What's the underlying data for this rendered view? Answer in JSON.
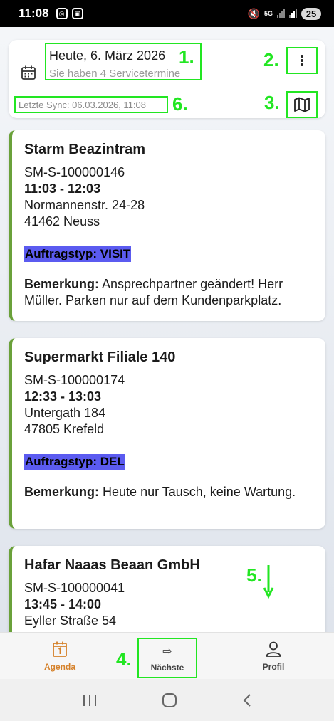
{
  "status_bar": {
    "time": "11:08",
    "network": "5G",
    "battery": "25"
  },
  "header": {
    "date_title": "Heute, 6. März 2026",
    "subtitle": "Sie haben 4 Servicetermine",
    "last_sync": "Letzte Sync: 06.03.2026, 11:08"
  },
  "annotations": {
    "a1": "1.",
    "a2": "2.",
    "a3": "3.",
    "a4": "4.",
    "a5": "5.",
    "a6": "6."
  },
  "appointments": [
    {
      "name": "Starm Beazintram",
      "id": "SM-S-100000146",
      "time": "11:03 - 12:03",
      "street": "Normannenstr. 24-28",
      "city": "41462 Neuss",
      "type": "Auftragstyp: VISIT",
      "remark_label": "Bemerkung:",
      "remark": " Ansprechpartner geändert! Herr Müller. Parken nur auf dem Kundenparkplatz."
    },
    {
      "name": "Supermarkt Filiale 140",
      "id": "SM-S-100000174",
      "time": "12:33 - 13:03",
      "street": "Untergath 184",
      "city": "47805 Krefeld",
      "type": "Auftragstyp: DEL",
      "remark_label": "Bemerkung:",
      "remark": " Heute nur Tausch, keine Wartung."
    },
    {
      "name": "Hafar Naaas Beaan GmbH",
      "id": "SM-S-100000041",
      "time": "13:45 - 14:00",
      "street": "Eyller Straße 54"
    }
  ],
  "bottom_nav": {
    "agenda": "Agenda",
    "next": "Nächste",
    "profil": "Profil"
  },
  "colors": {
    "accent_green_border": "#6aa13a",
    "annotation_green": "#22e622",
    "type_badge": "#5b5bf0",
    "agenda_active": "#d5812a"
  }
}
